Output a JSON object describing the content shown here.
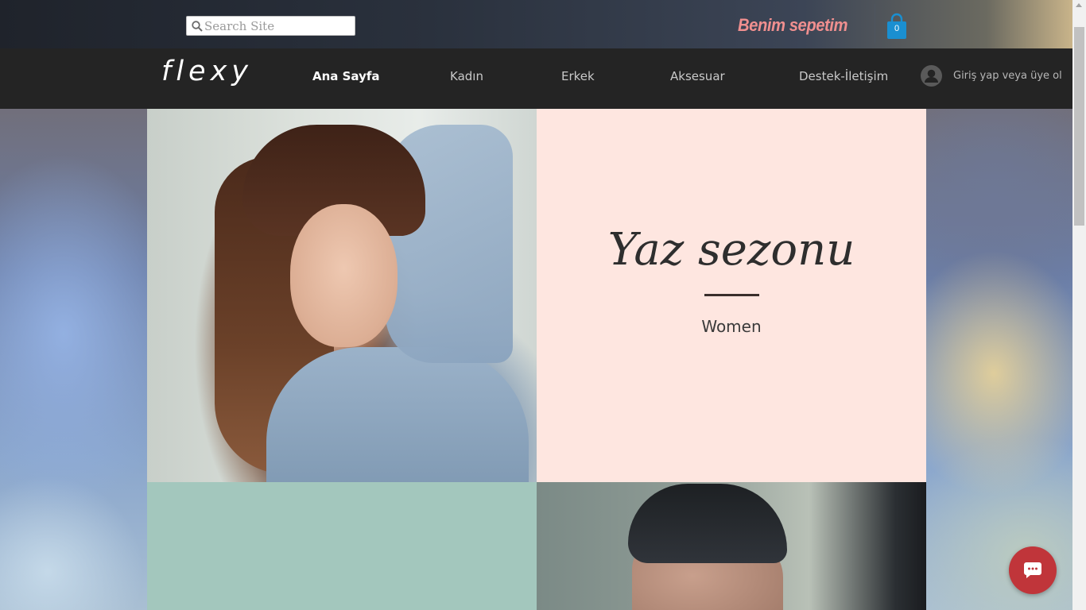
{
  "search": {
    "placeholder": "Search Site",
    "value": ""
  },
  "cart": {
    "label": "Benim sepetim",
    "count": "0"
  },
  "logo": "flexy",
  "nav": {
    "items": [
      {
        "label": "Ana Sayfa",
        "active": true
      },
      {
        "label": "Kadın",
        "active": false
      },
      {
        "label": "Erkek",
        "active": false
      },
      {
        "label": "Aksesuar",
        "active": false
      },
      {
        "label": "Destek-İletişim",
        "active": false
      }
    ],
    "login": "Giriş yap veya üye ol"
  },
  "hero": {
    "title": "Yaz sezonu",
    "subtitle": "Women"
  },
  "colors": {
    "promo_bg": "#fee6e0",
    "tile_green": "#a3c7bd",
    "cart_accent": "#f08f8f",
    "cart_bag": "#1a8fd1",
    "chat": "#c0353a",
    "nav_bg": "#242424"
  },
  "icons": {
    "search": "search-icon",
    "cart": "shopping-bag-icon",
    "user": "user-avatar-icon",
    "chat": "chat-bubble-icon"
  }
}
